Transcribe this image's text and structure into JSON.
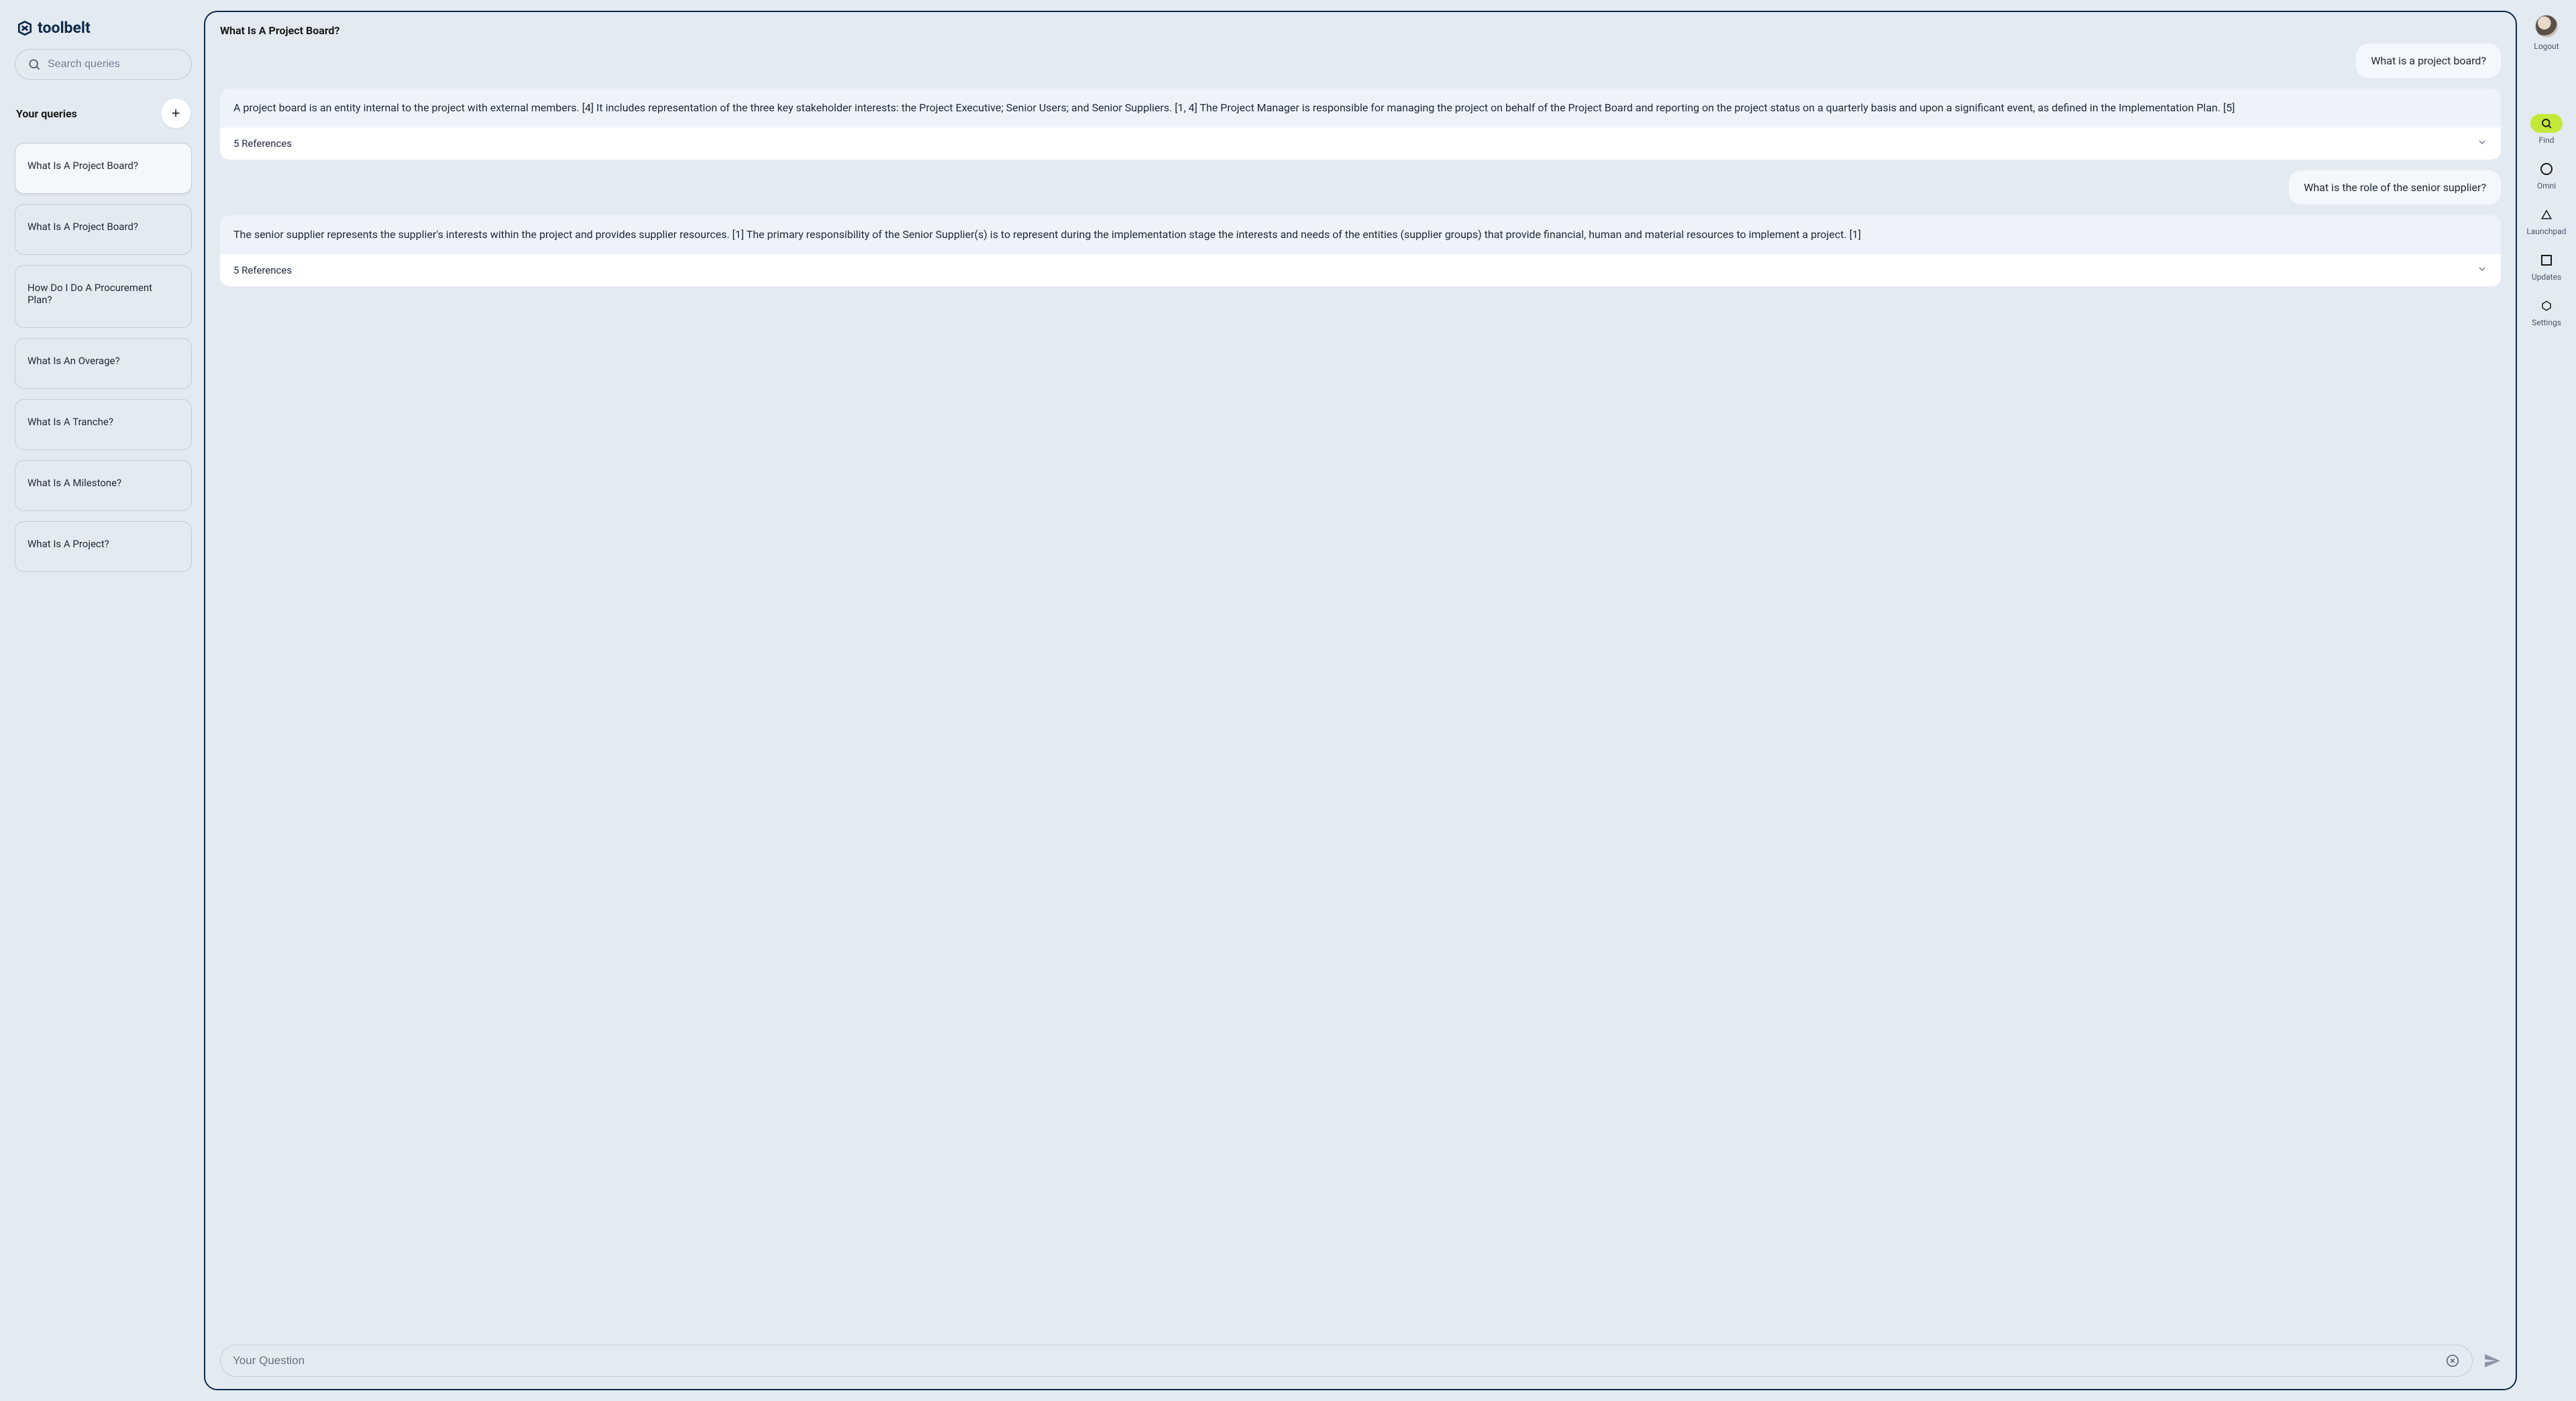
{
  "brand": {
    "name": "toolbelt"
  },
  "search": {
    "placeholder": "Search queries"
  },
  "sidebar": {
    "heading": "Your queries",
    "items": [
      {
        "label": "What Is A Project Board?",
        "active": true
      },
      {
        "label": "What Is A Project Board?",
        "active": false
      },
      {
        "label": "How Do I Do A Procurement Plan?",
        "active": false
      },
      {
        "label": "What Is An Overage?",
        "active": false
      },
      {
        "label": "What Is A Tranche?",
        "active": false
      },
      {
        "label": "What Is A Milestone?",
        "active": false
      },
      {
        "label": "What Is A Project?",
        "active": false
      }
    ]
  },
  "main": {
    "title": "What Is A Project Board?",
    "conversation": [
      {
        "role": "user",
        "text": "What is a project board?"
      },
      {
        "role": "assistant",
        "text": "A project board is an entity internal to the project with external members. [4] It includes representation of the three key stakeholder interests: the Project Executive; Senior Users; and Senior Suppliers. [1, 4] The Project Manager is responsible for managing the project on behalf of the Project Board and reporting on the project status on a quarterly basis and upon a significant event, as defined in the Implementation Plan. [5]",
        "references_label": "5 References"
      },
      {
        "role": "user",
        "text": "What is the role of the senior supplier?"
      },
      {
        "role": "assistant",
        "text": "The senior supplier represents the supplier's interests within the project and provides supplier resources. [1] The primary responsibility of the Senior Supplier(s) is to represent during the implementation stage the interests and needs of the entities (supplier groups) that provide financial, human and material resources to implement a project. [1]",
        "references_label": "5 References"
      }
    ],
    "input": {
      "placeholder": "Your Question"
    }
  },
  "rail": {
    "logout": "Logout",
    "items": [
      {
        "label": "Find",
        "icon": "search",
        "active": true
      },
      {
        "label": "Omni",
        "icon": "circle",
        "active": false
      },
      {
        "label": "Launchpad",
        "icon": "triangle",
        "active": false
      },
      {
        "label": "Updates",
        "icon": "square",
        "active": false
      },
      {
        "label": "Settings",
        "icon": "hexagon",
        "active": false
      }
    ]
  }
}
